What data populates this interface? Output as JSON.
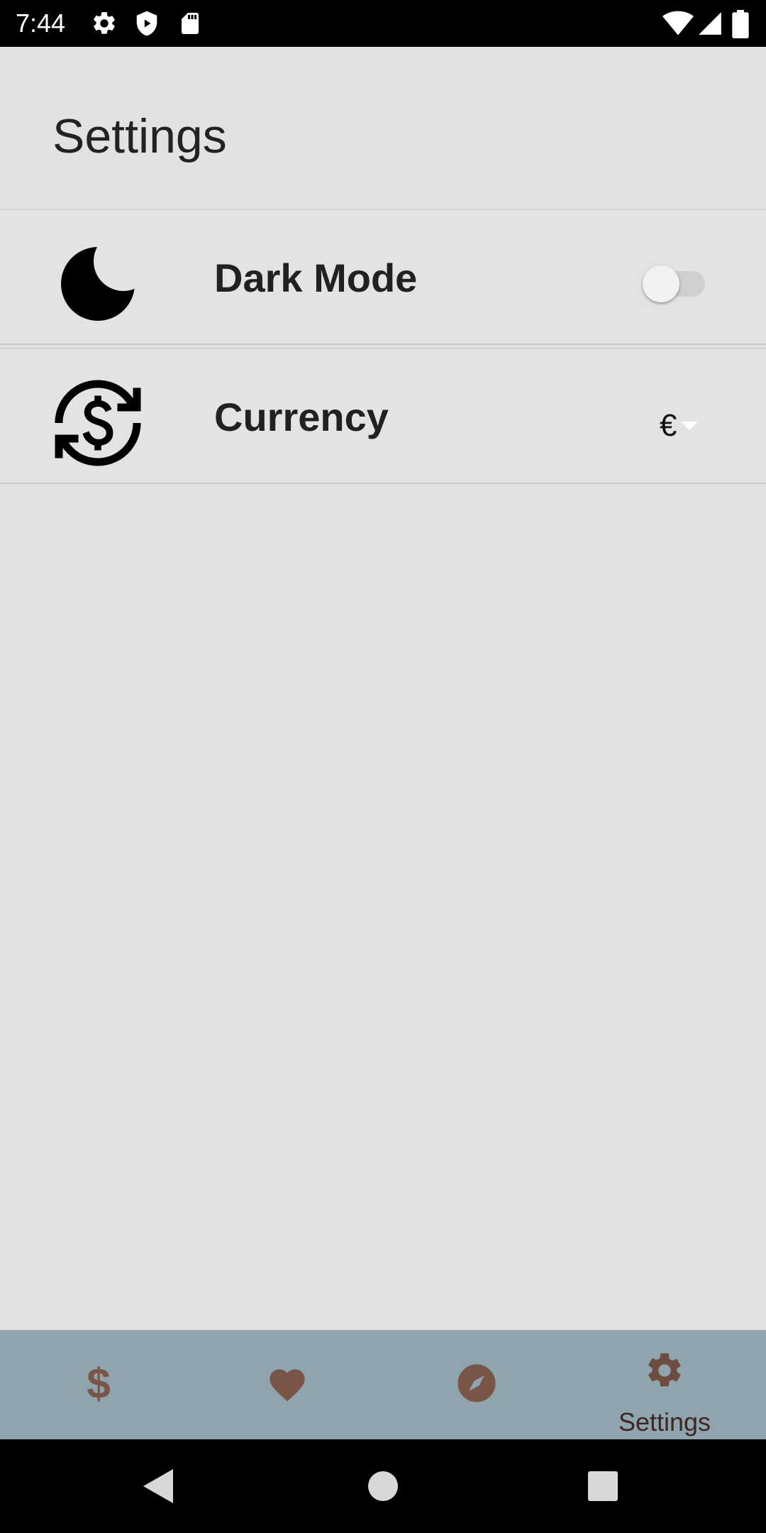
{
  "status_bar": {
    "time": "7:44",
    "icons": [
      "settings-icon",
      "shield-icon",
      "sd-card-icon",
      "wifi-icon",
      "signal-icon",
      "battery-icon"
    ]
  },
  "header": {
    "title": "Settings"
  },
  "settings": {
    "dark_mode": {
      "label": "Dark Mode",
      "icon": "moon-icon",
      "enabled": false
    },
    "currency": {
      "label": "Currency",
      "icon": "currency-exchange-icon",
      "value": "€"
    }
  },
  "bottom_nav": {
    "items": [
      {
        "icon": "dollar-icon",
        "label": ""
      },
      {
        "icon": "heart-icon",
        "label": ""
      },
      {
        "icon": "compass-icon",
        "label": ""
      },
      {
        "icon": "gear-icon",
        "label": "Settings",
        "active": true
      }
    ]
  },
  "colors": {
    "background": "#e2e2e2",
    "nav_background": "#90a4ae",
    "nav_icon": "#795548",
    "nav_active": "#6d4c41"
  }
}
